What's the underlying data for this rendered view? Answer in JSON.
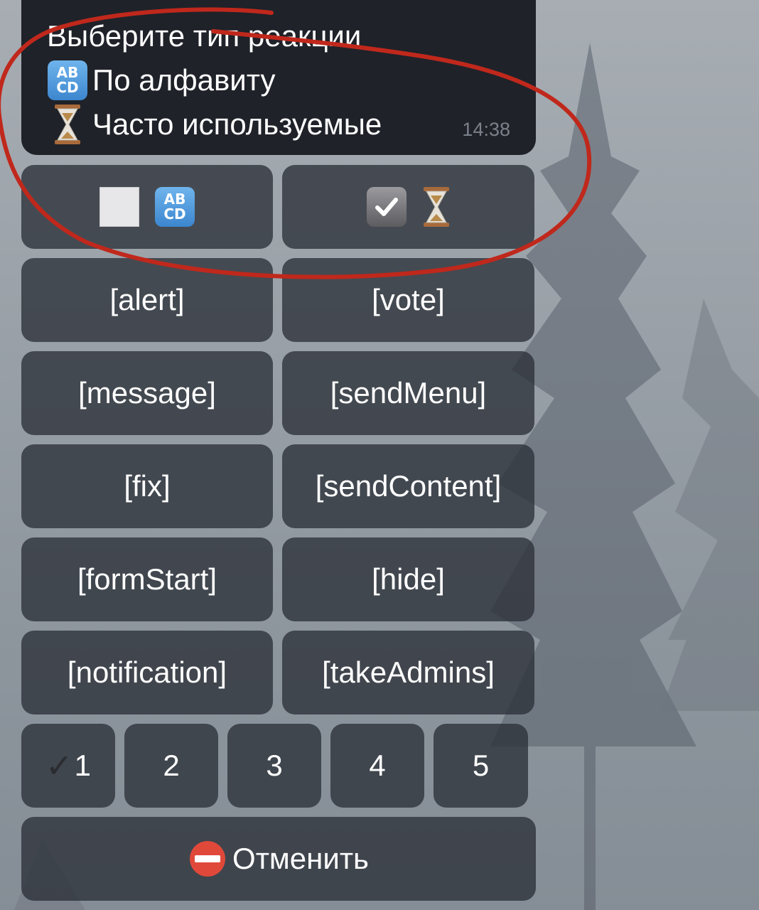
{
  "message": {
    "line1": "Выберите тип реакции",
    "line2": "По алфавиту",
    "line3": "Часто используемые",
    "line2_icon": "abcd-icon",
    "line3_icon": "hourglass-icon",
    "time": "14:38"
  },
  "keyboard": {
    "toggle_row": [
      {
        "icons": [
          "white-square-icon",
          "abcd-icon"
        ],
        "selected": false
      },
      {
        "icons": [
          "check-box-icon",
          "hourglass-icon"
        ],
        "selected": true
      }
    ],
    "action_rows": [
      [
        "[alert]",
        "[vote]"
      ],
      [
        "[message]",
        "[sendMenu]"
      ],
      [
        "[fix]",
        "[sendContent]"
      ],
      [
        "[formStart]",
        "[hide]"
      ],
      [
        "[notification]",
        "[takeAdmins]"
      ]
    ],
    "pages": [
      "1",
      "2",
      "3",
      "4",
      "5"
    ],
    "current_page": "1",
    "cancel_label": "Отменить",
    "cancel_icon": "no-entry-icon"
  },
  "annotation_color": "#c0281c"
}
